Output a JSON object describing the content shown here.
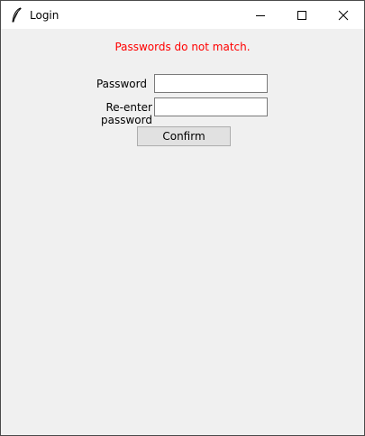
{
  "window": {
    "title": "Login",
    "icon": "feather-icon"
  },
  "titlebar": {
    "minimize_icon": "minimize-icon",
    "maximize_icon": "maximize-icon",
    "close_icon": "close-icon"
  },
  "form": {
    "error_message": "Passwords do not match.",
    "error_color": "#ff0000",
    "password_label": "Password",
    "password_value": "",
    "reenter_label": "Re-enter password",
    "reenter_value": "",
    "confirm_label": "Confirm"
  }
}
